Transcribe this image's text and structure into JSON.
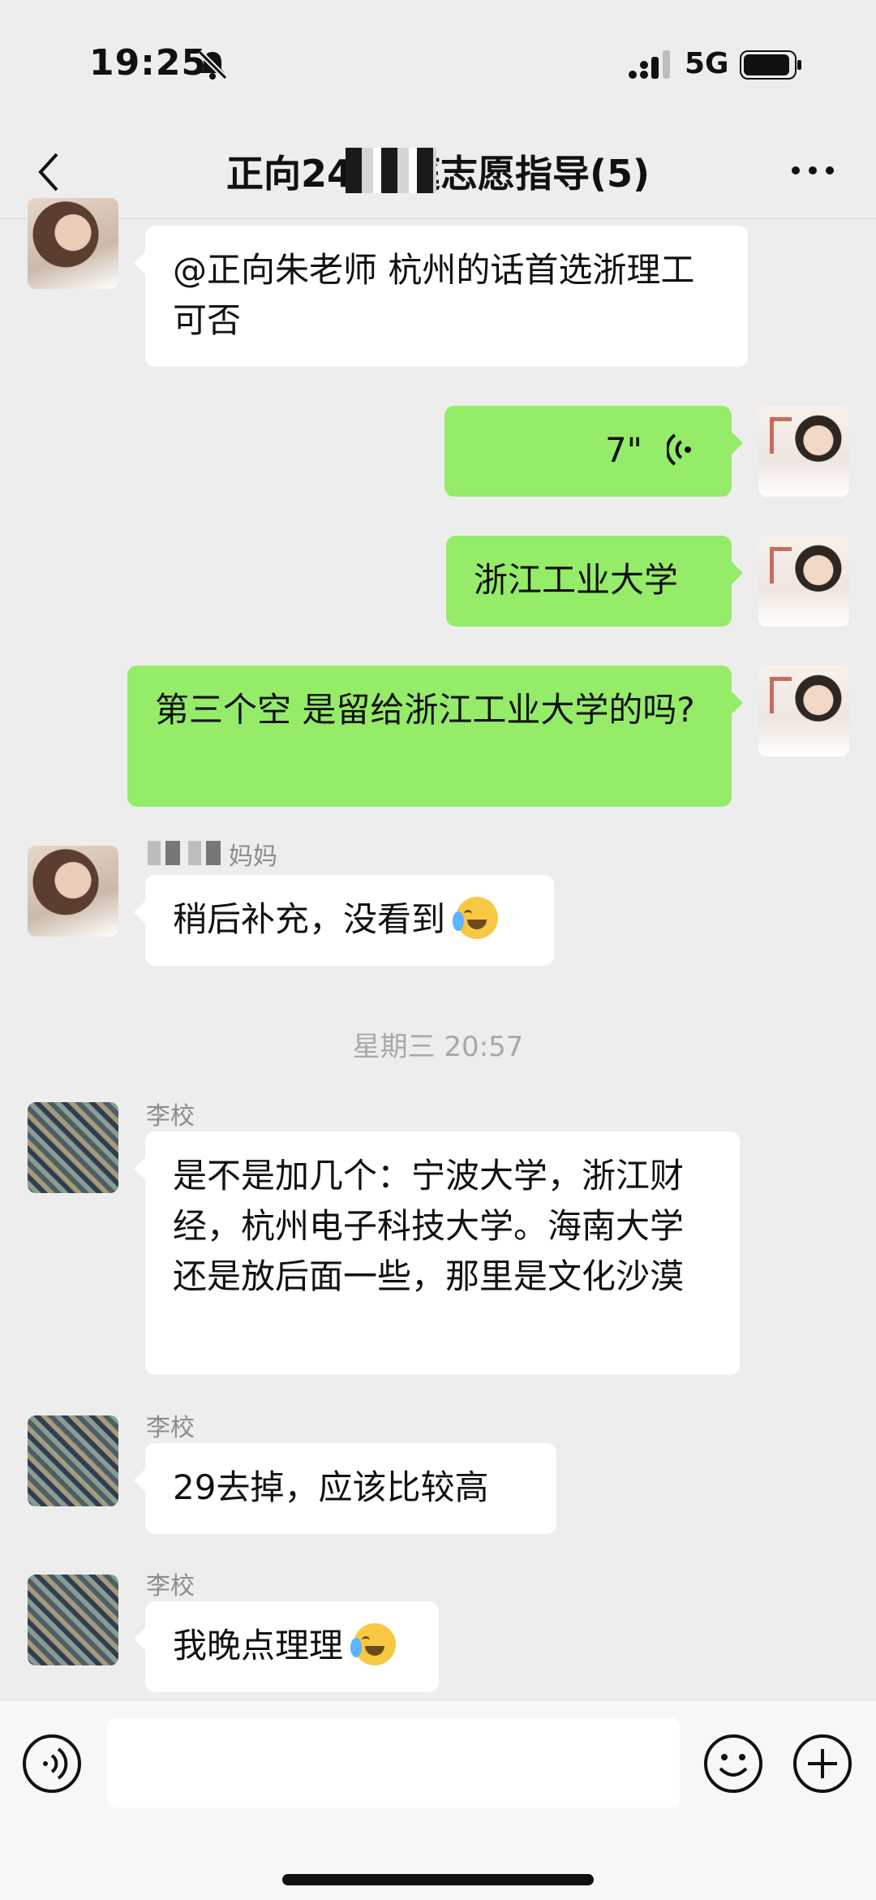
{
  "status_bar": {
    "time": "19:25",
    "network": "5G"
  },
  "header": {
    "title": "正向24届 庭志愿指导(5)"
  },
  "messages": [
    {
      "text": "@正向朱老师 杭州的话首选浙理工可否"
    },
    {
      "voice_duration": "7\""
    },
    {
      "text": "浙江工业大学"
    },
    {
      "text": "第三个空 是留给浙江工业大学的吗?"
    },
    {
      "sender": "妈妈",
      "text": "稍后补充，没看到"
    },
    {
      "timestamp": "星期三 20:57"
    },
    {
      "sender": "李校",
      "text": "是不是加几个：宁波大学，浙江财经，杭州电子科技大学。海南大学还是放后面一些，那里是文化沙漠"
    },
    {
      "sender": "李校",
      "text": "29去掉，应该比较高"
    },
    {
      "sender": "李校",
      "text": "我晚点理理"
    }
  ],
  "colors": {
    "background": "#ededed",
    "bubble_self": "#95ec69",
    "bubble_other": "#ffffff"
  },
  "icons": [
    "bell-slash-icon",
    "signal-icon",
    "battery-icon",
    "back-icon",
    "more-icon",
    "voice-wave-icon",
    "crying-laughing-emoji",
    "voice-mode-icon",
    "emoji-icon",
    "plus-icon"
  ]
}
